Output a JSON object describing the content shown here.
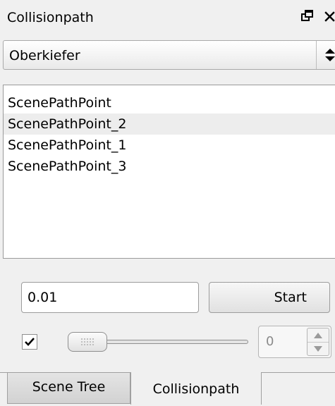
{
  "panel": {
    "title": "Collisionpath",
    "icons": {
      "float": "float-icon",
      "close": "close-icon"
    }
  },
  "combo": {
    "selected": "Oberkiefer",
    "icon": "up-down-arrows-icon"
  },
  "list": {
    "items": [
      "ScenePathPoint",
      "ScenePathPoint_2",
      "ScenePathPoint_1",
      "ScenePathPoint_3"
    ]
  },
  "controls": {
    "step_value": "0.01",
    "start_label": "Start",
    "checkbox_checked": true,
    "slider_value": 0,
    "spin_value": "0"
  },
  "tabs": [
    {
      "label": "Scene Tree",
      "active": false
    },
    {
      "label": "Collisionpath",
      "active": true
    }
  ],
  "colors": {
    "background": "#f0f0f0",
    "list_background": "#ffffff",
    "alternate_row": "#ededed",
    "border": "#9c9c9c"
  }
}
